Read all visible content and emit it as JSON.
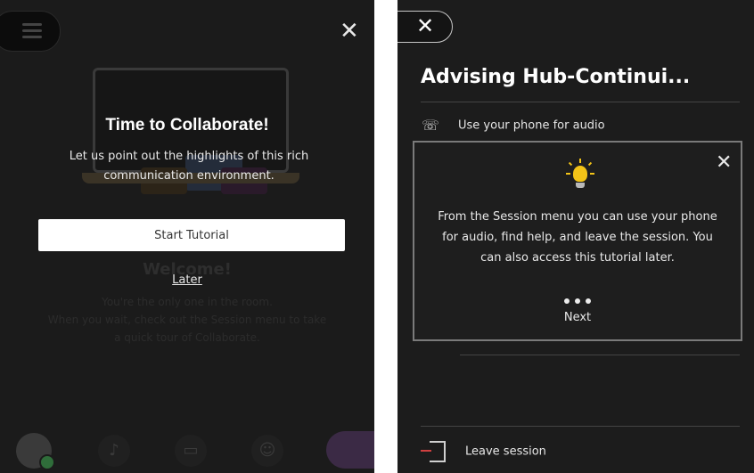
{
  "left": {
    "title": "Time to Collaborate!",
    "description": "Let us point out the highlights of this rich communication environment.",
    "start_button": "Start Tutorial",
    "later_link": "Later",
    "welcome": "Welcome!",
    "faint_line1": "You're the only one in the room.",
    "faint_line2": "When you wait, check out the Session menu to take",
    "faint_line3": "a quick tour of Collaborate.",
    "close": "✕"
  },
  "right": {
    "close": "✕",
    "session_title": "Advising Hub-Continui...",
    "menu": {
      "phone_audio": "Use your phone for audio",
      "leave_session": "Leave session"
    },
    "tip": {
      "close": "✕",
      "text": "From the Session menu you can use your phone for audio, find help, and leave the session. You can also access this tutorial later.",
      "next": "Next"
    }
  },
  "icons": {
    "menu": "hamburger-icon",
    "bulb": "lightbulb-icon",
    "phone": "phone-icon",
    "leave": "exit-icon"
  },
  "colors": {
    "panel_bg": "#1b1b1b",
    "bulb": "#f2c318",
    "leave_arrow": "#d04040"
  }
}
